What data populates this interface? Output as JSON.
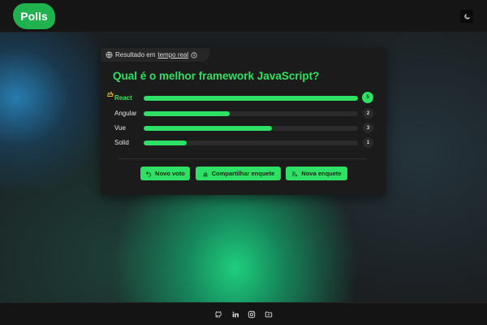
{
  "header": {
    "logo_text": "Polls",
    "theme_toggle_icon": "moon-icon"
  },
  "card": {
    "realtime_prefix": "Resultado em",
    "realtime_link": "tempo real",
    "question": "Qual é o melhor framework JavaScript?",
    "options": [
      {
        "label": "React",
        "votes": "5",
        "fraction": 1.0,
        "winner": true
      },
      {
        "label": "Angular",
        "votes": "2",
        "fraction": 0.4,
        "winner": false
      },
      {
        "label": "Vue",
        "votes": "3",
        "fraction": 0.6,
        "winner": false
      },
      {
        "label": "Solid",
        "votes": "1",
        "fraction": 0.2,
        "winner": false
      }
    ],
    "buttons": {
      "new_vote": "Novo voto",
      "share": "Compartilhar enquete",
      "new_poll": "Nova enquete"
    }
  },
  "footer": {
    "icons": [
      "github-icon",
      "linkedin-icon",
      "instagram-icon",
      "folder-icon"
    ]
  },
  "colors": {
    "accent": "#2ee063",
    "logo": "#1fb24f"
  }
}
